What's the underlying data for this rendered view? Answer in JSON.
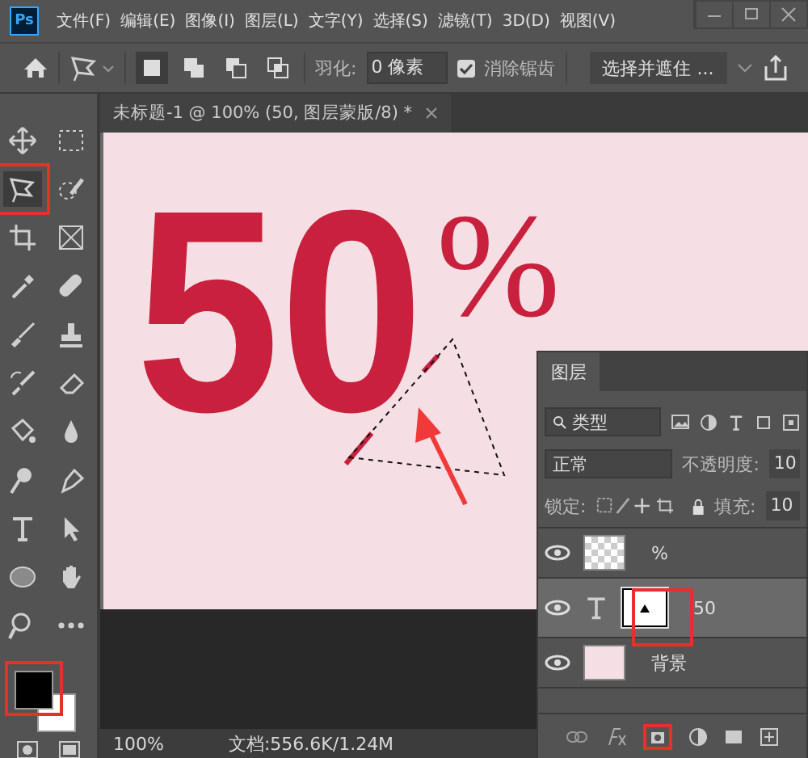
{
  "app": {
    "logo": "Ps"
  },
  "menu": [
    "文件(F)",
    "编辑(E)",
    "图像(I)",
    "图层(L)",
    "文字(Y)",
    "选择(S)",
    "滤镜(T)",
    "3D(D)",
    "视图(V)"
  ],
  "options": {
    "modes": [
      {
        "selected": true
      },
      {
        "selected": false
      },
      {
        "selected": false
      },
      {
        "selected": false
      }
    ],
    "feather_label": "羽化:",
    "feather_value": "0 像素",
    "antialias": {
      "label": "消除锯齿",
      "checked": true
    },
    "mask_button": "选择并遮住 ..."
  },
  "tools": [
    {
      "kind": "move",
      "selected": false
    },
    {
      "kind": "marquee",
      "selected": false
    },
    {
      "kind": "lasso",
      "selected": true
    },
    {
      "kind": "quick-select",
      "selected": false
    },
    {
      "kind": "crop",
      "selected": false
    },
    {
      "kind": "frame",
      "selected": false
    },
    {
      "kind": "eyedropper",
      "selected": false
    },
    {
      "kind": "bandage",
      "selected": false
    },
    {
      "kind": "brush",
      "selected": false
    },
    {
      "kind": "stamp",
      "selected": false
    },
    {
      "kind": "history-brush",
      "selected": false
    },
    {
      "kind": "eraser",
      "selected": false
    },
    {
      "kind": "bucket",
      "selected": false
    },
    {
      "kind": "drop",
      "selected": false
    },
    {
      "kind": "dodge",
      "selected": false
    },
    {
      "kind": "pen",
      "selected": false
    },
    {
      "kind": "type",
      "selected": false
    },
    {
      "kind": "pointer",
      "selected": false
    },
    {
      "kind": "ellipse",
      "selected": false
    },
    {
      "kind": "hand",
      "selected": false
    },
    {
      "kind": "zoom",
      "selected": false
    },
    {
      "kind": "more",
      "selected": false
    }
  ],
  "swatches": [
    {
      "color": "#000000"
    },
    {
      "color": "#ffffff"
    }
  ],
  "document": {
    "tab_title": "未标题-1 @ 100% (50, 图层蒙版/8) *",
    "canvas": {
      "big_text": "50",
      "symbol": "%"
    }
  },
  "status_bar": {
    "zoom": "100%",
    "doc_info": "文档:556.6K/1.24M"
  },
  "layers_panel": {
    "title": "图层",
    "filter": "类型",
    "blend_mode": "正常",
    "opacity_label": "不透明度:",
    "opacity_value": "10",
    "lock_label": "锁定:",
    "fill_label": "填充:",
    "fill_value": "10",
    "layers": [
      {
        "kind": "image",
        "name": "%",
        "visible": true,
        "selected": false
      },
      {
        "kind": "text",
        "name": "50",
        "visible": true,
        "selected": true
      },
      {
        "kind": "background",
        "name": "背景",
        "visible": true,
        "selected": false
      }
    ]
  }
}
